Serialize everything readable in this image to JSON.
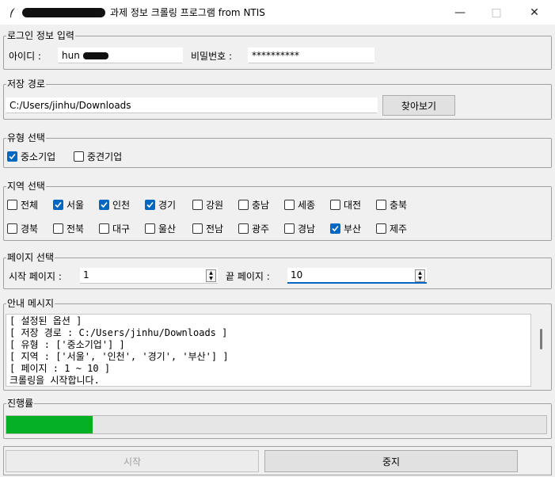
{
  "window": {
    "title": "과제 정보 크롤링 프로그램 from NTIS"
  },
  "login": {
    "legend": "로그인 정보 입력",
    "id_label": "아이디 :",
    "id_value": "hun",
    "pw_label": "비밀번호 :",
    "pw_value": "**********"
  },
  "save": {
    "legend": "저장 경로",
    "path": "C:/Users/jinhu/Downloads",
    "browse_label": "찾아보기"
  },
  "type": {
    "legend": "유형 선택",
    "options": [
      {
        "label": "중소기업",
        "checked": true
      },
      {
        "label": "중견기업",
        "checked": false
      }
    ]
  },
  "region": {
    "legend": "지역 선택",
    "row1": [
      {
        "label": "전체",
        "checked": false
      },
      {
        "label": "서울",
        "checked": true
      },
      {
        "label": "인천",
        "checked": true
      },
      {
        "label": "경기",
        "checked": true
      },
      {
        "label": "강원",
        "checked": false
      },
      {
        "label": "충남",
        "checked": false
      },
      {
        "label": "세종",
        "checked": false
      },
      {
        "label": "대전",
        "checked": false
      },
      {
        "label": "충북",
        "checked": false
      }
    ],
    "row2": [
      {
        "label": "경북",
        "checked": false
      },
      {
        "label": "전북",
        "checked": false
      },
      {
        "label": "대구",
        "checked": false
      },
      {
        "label": "울산",
        "checked": false
      },
      {
        "label": "전남",
        "checked": false
      },
      {
        "label": "광주",
        "checked": false
      },
      {
        "label": "경남",
        "checked": false
      },
      {
        "label": "부산",
        "checked": true
      },
      {
        "label": "제주",
        "checked": false
      }
    ]
  },
  "page": {
    "legend": "페이지 선택",
    "start_label": "시작 페이지 :",
    "start_value": "1",
    "end_label": "끝 페이지 :",
    "end_value": "10"
  },
  "message": {
    "legend": "안내 메시지",
    "lines": [
      "[ 설정된 옵션 ]",
      "[ 저장 경로 : C:/Users/jinhu/Downloads ]",
      "[ 유형 : ['중소기업'] ]",
      "[ 지역 : ['서울', '인천', '경기', '부산'] ]",
      "[ 페이지 : 1 ~ 10 ]",
      "크롤링을 시작합니다."
    ]
  },
  "progress": {
    "legend": "진행률",
    "percent": 16,
    "color": "#06b025"
  },
  "actions": {
    "start_label": "시작",
    "stop_label": "중지"
  },
  "colors": {
    "accent": "#0067c0",
    "background": "#f0f0f0"
  }
}
